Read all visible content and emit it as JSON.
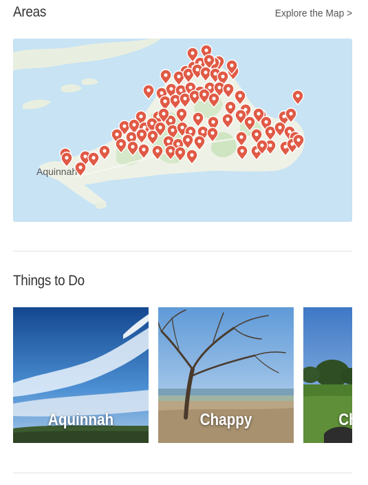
{
  "areas": {
    "title": "Areas",
    "explore_link": "Explore the Map >",
    "map": {
      "place_label": "Aquinnah",
      "marker_icon": "map-pin-icon",
      "marker_color": "#e05a45",
      "water_color": "#c7e3f4"
    }
  },
  "things_to_do": {
    "title": "Things to Do",
    "cards": [
      {
        "label": "Aquinnah"
      },
      {
        "label": "Chappy"
      },
      {
        "label": "Ch"
      }
    ]
  }
}
